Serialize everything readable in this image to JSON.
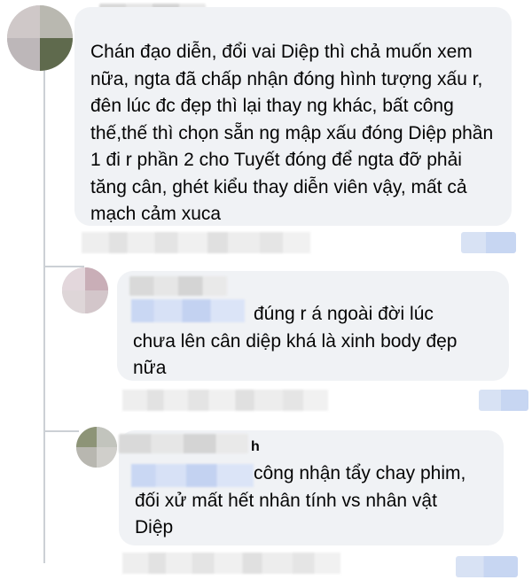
{
  "comments": [
    {
      "text": "Chán đạo diễn, đổi vai Diệp thì chả muốn xem nữa, ngta đã chấp nhận đóng hình tượng xấu r, đên lúc đc đẹp thì lại thay ng khác, bất công thế,thế thì chọn sẵn ng mập xấu đóng Diệp phần 1 đi r phần 2 cho Tuyết đóng để ngta đỡ phải tăng cân, ghét kiểu thay diễn viên vậy, mất cả mạch cảm xuca"
    },
    {
      "text": "đúng r á ngoài đời lúc\nchưa lên cân diệp khá là xinh body đẹp\nnữa"
    },
    {
      "name_visible_fragment": "h",
      "text": "công nhận tẩy chay phim,\nđối xử mất hết nhân tính vs nhân vật\nDiệp"
    }
  ],
  "colors": {
    "bubble": "#f0f2f5",
    "text": "#050505",
    "tag_highlight": "#c9d7f3",
    "thread_line": "#ccd0d5"
  }
}
